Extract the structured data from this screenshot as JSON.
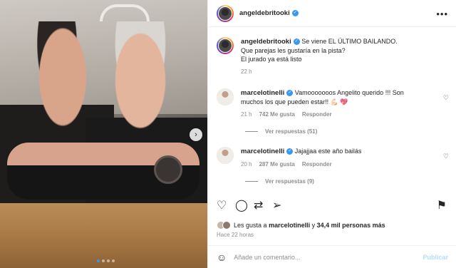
{
  "post": {
    "author": "angeldebritooki",
    "photo_dots": 4,
    "active_dot": 0
  },
  "caption": {
    "username": "angeldebritooki",
    "text_line1": "Se viene EL ÚLTIMO BAILANDO.",
    "text_line2": "Que parejas les gustaría en la pista?",
    "text_line3": "El jurado ya está listo",
    "time": "22 h"
  },
  "comments": [
    {
      "username": "marcelotinelli",
      "text_line1": "Vamooooooos Angelito querido !!! Son",
      "text_line2": "muchos los que pueden estar!! 💪🏻 💖",
      "time": "21 h",
      "likes": "742 Me gusta",
      "reply": "Responder",
      "view_replies": "Ver respuestas (51)"
    },
    {
      "username": "marcelotinelli",
      "text_line1": "Jajajjaa este año bailás",
      "time": "20 h",
      "likes": "287 Me gusta",
      "reply": "Responder",
      "view_replies": "Ver respuestas (9)"
    }
  ],
  "likes": {
    "prefix": "Les gusta a",
    "user": "marcelotinelli",
    "connector": "y",
    "others": "34,4 mil personas más"
  },
  "posted_ago": "Hace 22 horas",
  "add_comment": {
    "placeholder": "Añade un comentario...",
    "post_label": "Publicar"
  },
  "icons": {
    "verified": "verified-badge",
    "more": "more-icon",
    "heart": "heart-icon",
    "comment": "comment-icon",
    "share": "share-icon",
    "send": "send-icon",
    "save": "bookmark-icon",
    "emoji": "emoji-icon",
    "next": "chevron-right-icon"
  },
  "colors": {
    "accent": "#3897f0",
    "muted": "#8e8e8e",
    "post_disabled": "#b2dffc"
  }
}
